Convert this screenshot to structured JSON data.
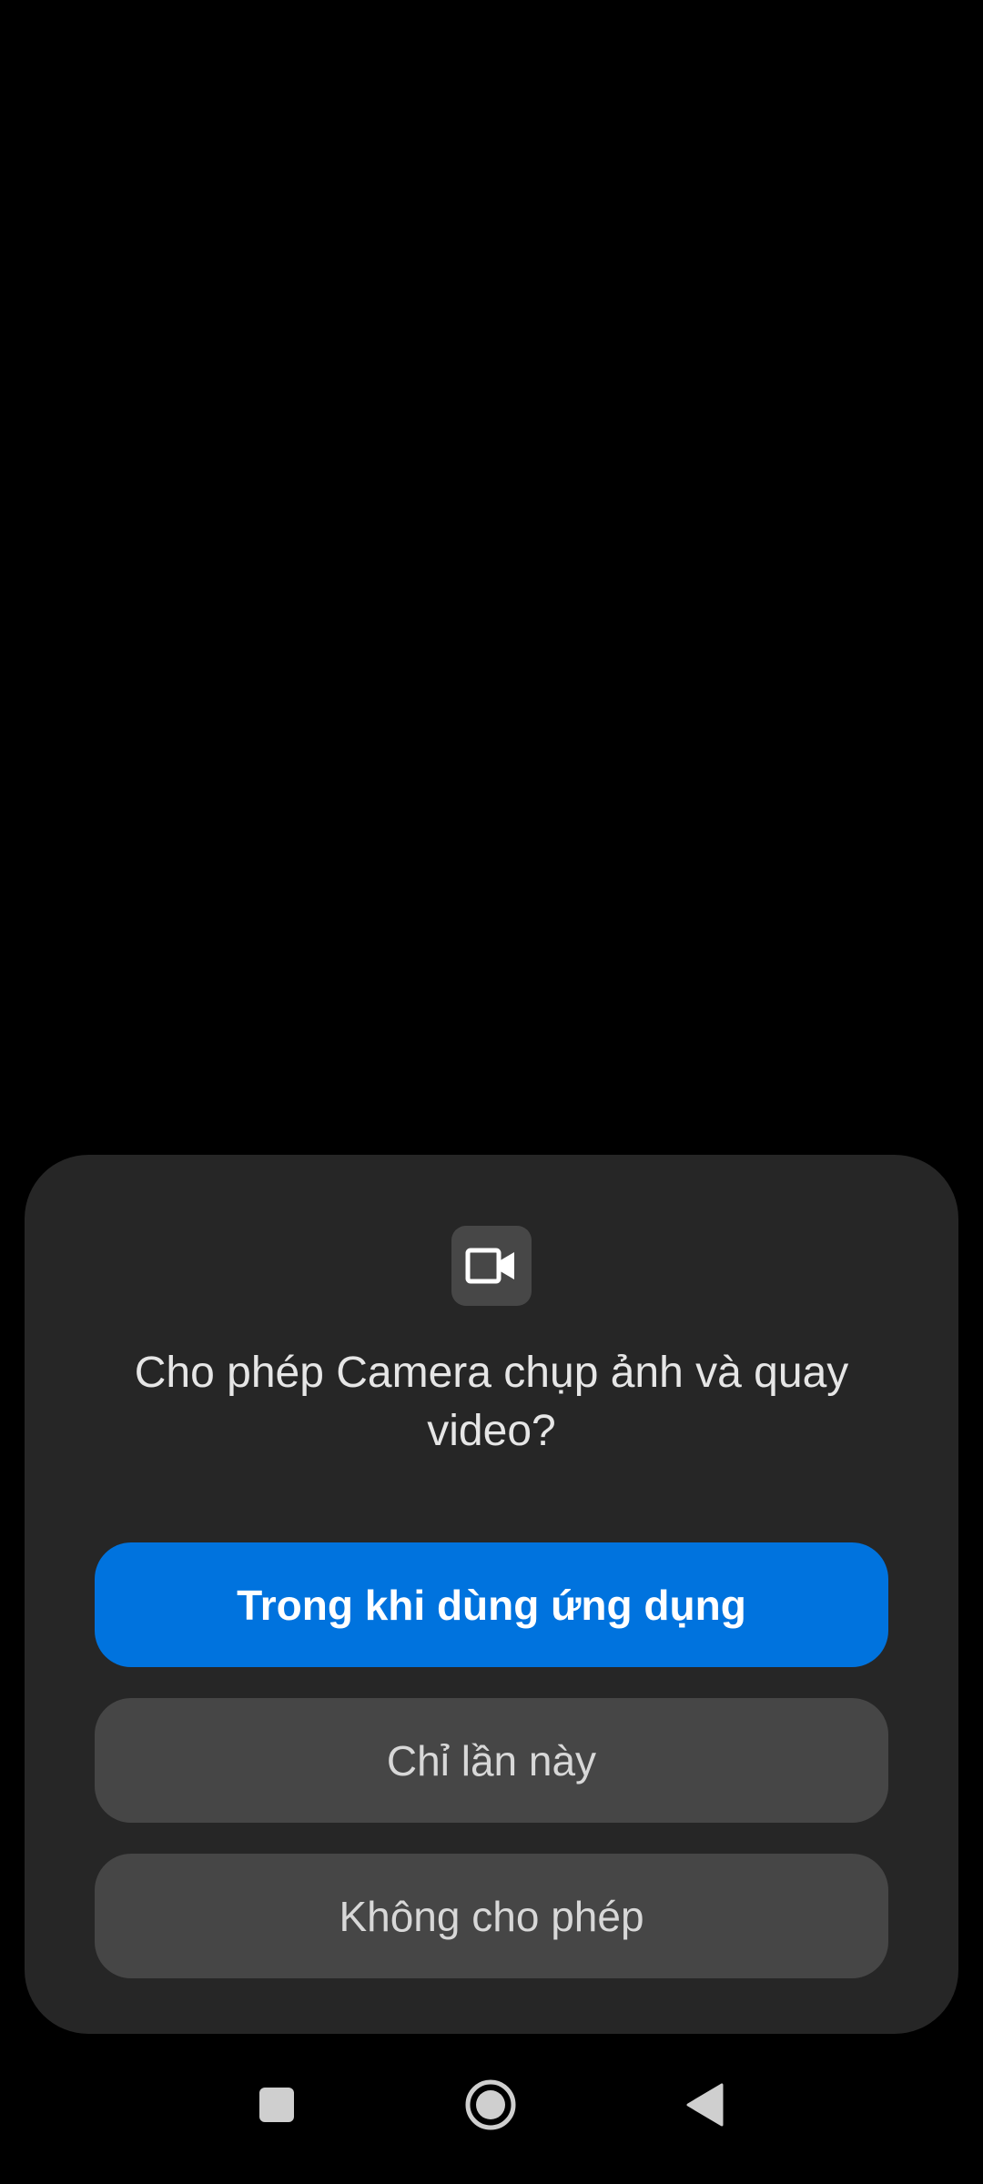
{
  "dialog": {
    "icon": "video-camera-icon",
    "title": "Cho phép Camera chụp ảnh và quay video?",
    "buttons": {
      "while_using": "Trong khi dùng ứng dụng",
      "only_this_time": "Chỉ lần này",
      "deny": "Không cho phép"
    }
  },
  "navbar": {
    "recent": "recent-apps-icon",
    "home": "home-icon",
    "back": "back-icon"
  },
  "colors": {
    "background": "#000000",
    "dialog": "#262626",
    "primary_button": "#0073de",
    "secondary_button": "#464646",
    "nav_icon": "#cfcfcf"
  }
}
